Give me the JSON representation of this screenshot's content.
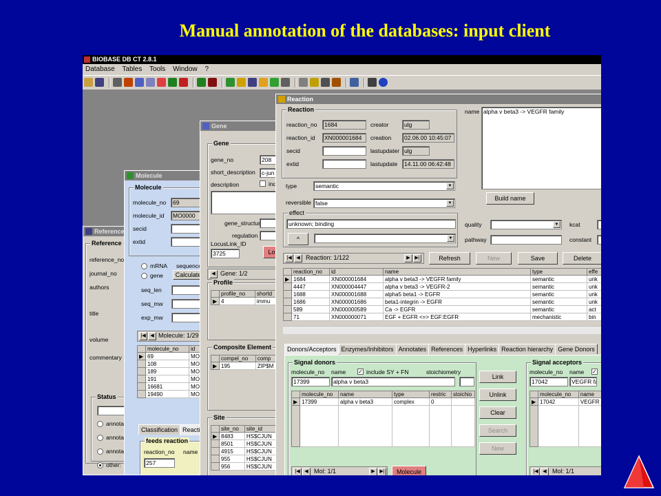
{
  "slide": {
    "title": "Manual annotation of the databases: input client"
  },
  "app": {
    "title": "BIOBASE DB CT 2.8.1",
    "menu": [
      "Database",
      "Tables",
      "Tools",
      "Window",
      "?"
    ]
  },
  "reference_win": {
    "title": "Reference",
    "group": "Reference",
    "fields": [
      "reference_no",
      "journal_no",
      "authors",
      "title",
      "volume",
      "commentary"
    ],
    "status_group": "Status",
    "status_options": [
      "annotat",
      "annotat",
      "annotati",
      "other:"
    ]
  },
  "molecule_win": {
    "title": "Molecule",
    "group": "Molecule",
    "molecule_no": "69",
    "molecule_id": "MO0000",
    "labels": {
      "molecule_no": "molecule_no",
      "molecule_id": "molecule_id",
      "secid": "secid",
      "extid": "extid",
      "mrna": "mRNA",
      "gene": "gene",
      "sequence": "sequence",
      "calculate": "Calculate",
      "seq_len": "seq_len",
      "seq_mw": "seq_mw",
      "exp_mw": "exp_mw"
    },
    "nav": "Molecule: 1/29",
    "columns": [
      "molecule_no",
      "id"
    ],
    "rows": [
      [
        "69",
        "MO0"
      ],
      [
        "108",
        "MO0"
      ],
      [
        "189",
        "MO0"
      ],
      [
        "191",
        "MO0"
      ],
      [
        "16681",
        "MO0"
      ],
      [
        "19490",
        "MO0"
      ]
    ],
    "tabs": [
      "Classification",
      "Reacti"
    ],
    "feeds_group": "feeds reaction",
    "feeds_cols": [
      "reaction_no",
      "name"
    ],
    "feeds_value": "257"
  },
  "gene_win": {
    "title": "Gene",
    "group": "Gene",
    "gene_no": "208",
    "short_description": "c-jun",
    "labels": {
      "gene_no": "gene_no",
      "short_description": "short_description",
      "description": "description",
      "ind": "ind",
      "gene_structure": "gene_structure",
      "regulation": "regulation",
      "locuslink": "LocusLink_ID",
      "lo": "Lo"
    },
    "locuslink": "3725",
    "nav": "Gene: 1/2",
    "profile_group": "Profile",
    "profile_cols": [
      "profile_no",
      "shortd"
    ],
    "profile_row": [
      "4",
      "immu"
    ],
    "composite_group": "Composite Element",
    "composite_cols": [
      "compel_no",
      "comp"
    ],
    "composite_row": [
      "195",
      "ZIP$M"
    ],
    "site_group": "Site",
    "site_cols": [
      "site_no",
      "site_id"
    ],
    "site_rows": [
      [
        "8483",
        "HS$CJUN"
      ],
      [
        "8501",
        "HS$CJUN"
      ],
      [
        "4915",
        "HS$CJUN"
      ],
      [
        "955",
        "HS$CJUN"
      ],
      [
        "956",
        "HS$CJUN"
      ]
    ]
  },
  "reaction_win": {
    "title": "Reaction",
    "group": "Reaction",
    "labels": {
      "reaction_no": "reaction_no",
      "reaction_id": "reaction_id",
      "secid": "secid",
      "extid": "extid",
      "creator": "creator",
      "creation": "creation",
      "lastupdater": "lastupdater",
      "lastupdate": "lastupdate",
      "name": "name",
      "type": "type",
      "reversible": "reversible",
      "effect": "effect",
      "quality": "quality",
      "pathway": "pathway",
      "kcat": "kcat",
      "constant": "constant"
    },
    "reaction_no": "1684",
    "reaction_id": "XN000001684",
    "creator": "ulg",
    "creation": "02.06.00 10:45:07",
    "lastupdater": "ulg",
    "lastupdate": "14.11.00 06:42:48",
    "name": "alpha v beta3 -> VEGFR family",
    "type": "semantic",
    "reversible": "false",
    "effect": "unknown; binding",
    "build_name": "Build name",
    "nav": "Reaction: 1/122",
    "buttons": {
      "refresh": "Refresh",
      "new": "New",
      "save": "Save",
      "delete": "Delete",
      "up": "^"
    },
    "columns": [
      "reaction_no",
      "id",
      "name",
      "type",
      "effe"
    ],
    "rows": [
      [
        "1684",
        "XN000001684",
        "alpha v beta3 -> VEGFR family",
        "semantic",
        "unk"
      ],
      [
        "4447",
        "XN000004447",
        "alpha v beta3 -> VEGFR-2",
        "semantic",
        "unk"
      ],
      [
        "1688",
        "XN000001688",
        "alpha5 beta1 -> EGFR",
        "semantic",
        "unk"
      ],
      [
        "1686",
        "XN000001686",
        "beta1-integrin -> EGFR",
        "semantic",
        "unk"
      ],
      [
        "589",
        "XN000000589",
        "Ca -> EGFR",
        "semantic",
        "act"
      ],
      [
        "71",
        "XN000000071",
        "EGF + EGFR <=> EGF:EGFR",
        "mechanistic",
        "bin"
      ]
    ],
    "tabs": [
      "Donors/Acceptors",
      "Enzymes/Inhibitors",
      "Annotates",
      "References",
      "Hyperlinks",
      "Reaction hierarchy",
      "Gene Donors"
    ],
    "donors": {
      "group": "Signal donors",
      "molecule_no_label": "molecule_no",
      "name_label": "name",
      "include_label": "include SY + FN",
      "stoich_label": "stoichiometry",
      "molecule_no": "17399",
      "name": "alpha v beta3",
      "columns": [
        "molecule_no",
        "name",
        "type",
        "restric",
        "stoichio"
      ],
      "row": [
        "17399",
        "alpha v beta3",
        "complex",
        "0",
        ""
      ],
      "nav": "Mol: 1/1",
      "molecule_btn": "Molecule"
    },
    "link_buttons": [
      "Link",
      "Unlink",
      "Clear",
      "Search",
      "New"
    ],
    "acceptors": {
      "group": "Signal acceptors",
      "molecule_no_label": "molecule_no",
      "name_label": "name",
      "molecule_no": "17042",
      "name": "VEGFR fa",
      "columns": [
        "molecule_no",
        "name"
      ],
      "row": [
        "17042",
        "VEGFR"
      ],
      "nav": "Mol: 1/1"
    }
  }
}
